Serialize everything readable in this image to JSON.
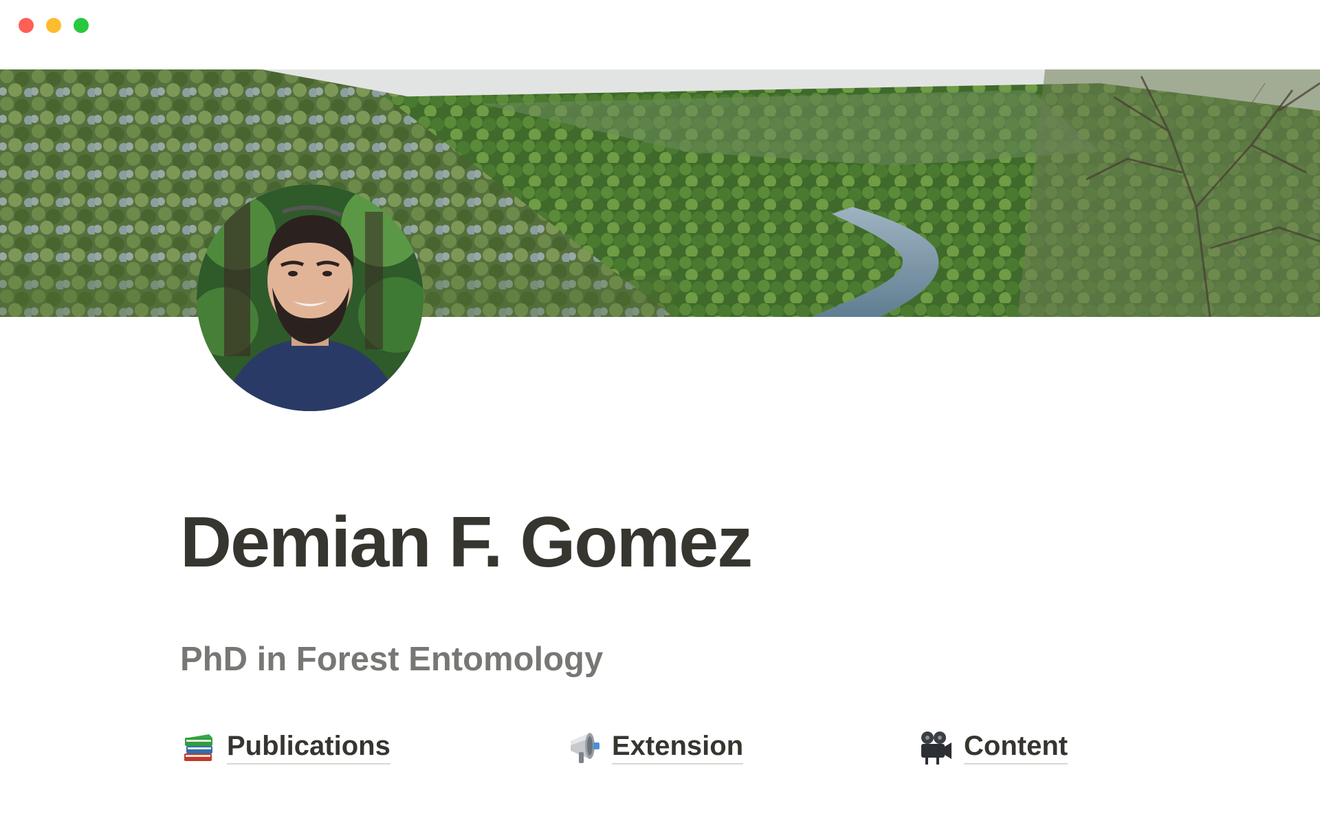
{
  "window": {
    "controls": {
      "close_color": "#ff5f57",
      "minimize_color": "#febc2e",
      "maximize_color": "#28c840"
    }
  },
  "cover": {
    "image": "forest-river-valley-landscape"
  },
  "profile": {
    "avatar": "profile-photo-portrait",
    "name": "Demian F. Gomez",
    "subtitle": "PhD in Forest Entomology"
  },
  "links": [
    {
      "icon": "books-icon",
      "label": "Publications"
    },
    {
      "icon": "megaphone-icon",
      "label": "Extension"
    },
    {
      "icon": "movie-camera-icon",
      "label": "Content"
    }
  ],
  "colors": {
    "title_text": "#37352f",
    "subtitle_text": "#787774",
    "link_underline": "#d7d6d3"
  }
}
